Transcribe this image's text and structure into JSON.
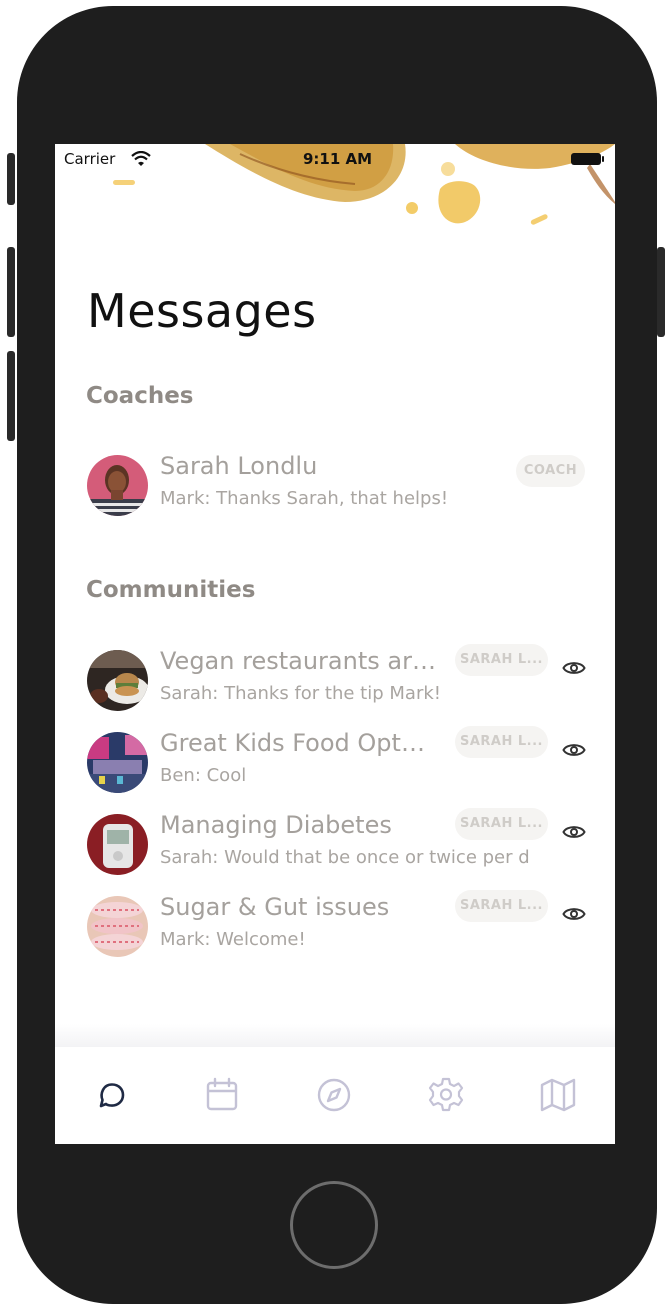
{
  "status_bar": {
    "carrier": "Carrier",
    "time": "9:11 AM"
  },
  "page": {
    "title": "Messages"
  },
  "coaches": {
    "heading": "Coaches",
    "items": [
      {
        "name": "Sarah Londlu",
        "preview": "Mark: Thanks Sarah, that helps!",
        "tag": "COACH"
      }
    ]
  },
  "communities": {
    "heading": "Communities",
    "items": [
      {
        "name": "Vegan restaurants ar…",
        "preview": "Sarah: Thanks for the tip Mark!",
        "tag": "SARAH L..."
      },
      {
        "name": "Great Kids Food Opt…",
        "preview": "Ben: Cool",
        "tag": "SARAH L..."
      },
      {
        "name": "Managing Diabetes",
        "preview": "Sarah: Would that be once or twice per d",
        "tag": "SARAH L..."
      },
      {
        "name": "Sugar & Gut issues",
        "preview": "Mark: Welcome!",
        "tag": "SARAH L..."
      }
    ]
  },
  "tab_bar": {
    "tabs": [
      {
        "icon": "chat-bubble-icon",
        "active": true
      },
      {
        "icon": "calendar-icon",
        "active": false
      },
      {
        "icon": "compass-icon",
        "active": false
      },
      {
        "icon": "gear-icon",
        "active": false
      },
      {
        "icon": "map-icon",
        "active": false
      }
    ],
    "active_color": "#1f2a44",
    "inactive_color": "#c4c2d6"
  }
}
